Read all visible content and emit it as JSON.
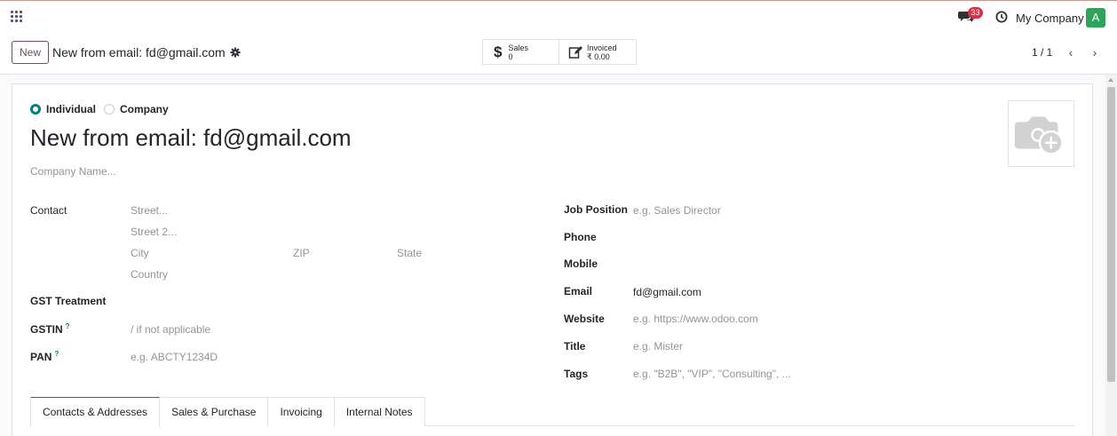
{
  "navbar": {
    "chat_count": "33",
    "company": "My Company",
    "avatar_letter": "A"
  },
  "control": {
    "new_label": "New",
    "record_title": "New from email: fd@gmail.com",
    "sales_label": "Sales",
    "sales_value": "0",
    "invoiced_label": "Invoiced",
    "invoiced_value": "₹ 0.00",
    "pager": "1 / 1"
  },
  "form": {
    "type_individual": "Individual",
    "type_company": "Company",
    "name": "New from email: fd@gmail.com",
    "company_placeholder": "Company Name...",
    "contact_label": "Contact",
    "street_ph": "Street...",
    "street2_ph": "Street 2...",
    "city_ph": "City",
    "zip_ph": "ZIP",
    "state_ph": "State",
    "country_ph": "Country",
    "gst_treatment_label": "GST Treatment",
    "gstin_label": "GSTIN",
    "gstin_ph": "/ if not applicable",
    "pan_label": "PAN",
    "pan_ph": "e.g. ABCTY1234D",
    "help_mark": "?",
    "job_label": "Job Position",
    "job_ph": "e.g. Sales Director",
    "phone_label": "Phone",
    "mobile_label": "Mobile",
    "email_label": "Email",
    "email_value": "fd@gmail.com",
    "website_label": "Website",
    "website_ph": "e.g. https://www.odoo.com",
    "title_label": "Title",
    "title_ph": "e.g. Mister",
    "tags_label": "Tags",
    "tags_ph": "e.g. \"B2B\", \"VIP\", \"Consulting\", ..."
  },
  "tabs": [
    "Contacts & Addresses",
    "Sales & Purchase",
    "Invoicing",
    "Internal Notes"
  ],
  "colors": {
    "brand": "#714b67",
    "radio_active": "#017e84",
    "badge": "#d9304a",
    "avatar": "#2fa35a"
  }
}
